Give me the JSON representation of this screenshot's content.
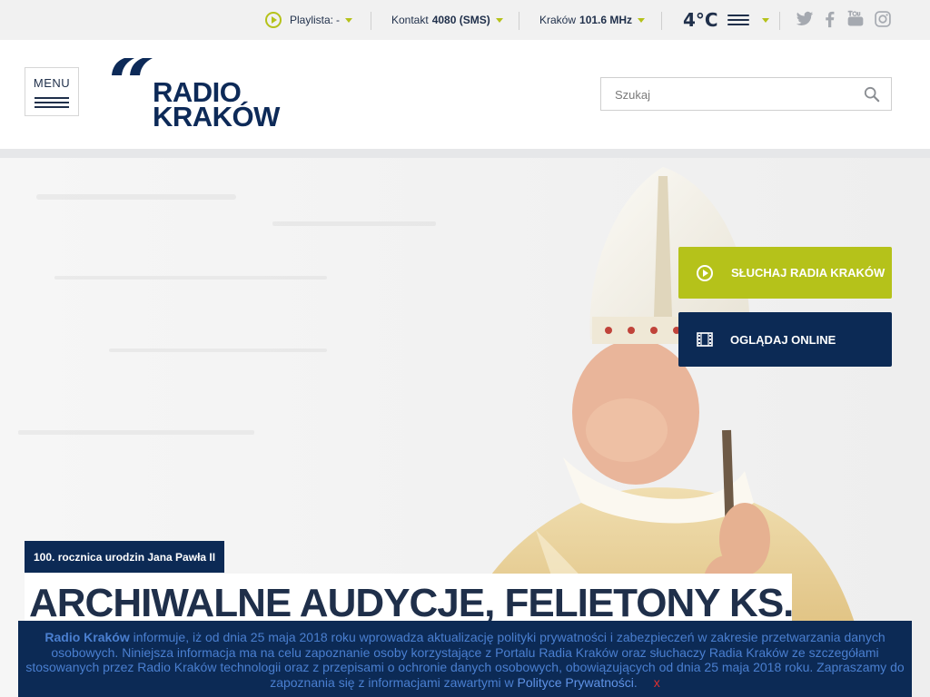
{
  "topbar": {
    "playlist_label": "Playlista:",
    "playlist_value": "-",
    "contact_label": "Kontakt",
    "contact_value": "4080 (SMS)",
    "city_label": "Kraków",
    "frequency": "101.6 MHz",
    "temperature": "4°C",
    "weather_icon": "fog-icon",
    "social": [
      "twitter-icon",
      "facebook-icon",
      "youtube-icon",
      "instagram-icon"
    ]
  },
  "header": {
    "menu_label": "MENU",
    "logo_line1": "RADIO",
    "logo_line2": "KRAKÓW",
    "search_placeholder": "Szukaj"
  },
  "hero": {
    "listen_label": "SŁUCHAJ RADIA KRAKÓW",
    "watch_label": "OGLĄDAJ ONLINE",
    "tag": "100. rocznica urodzin Jana Pawła II",
    "headline": "ARCHIWALNE AUDYCJE, FELIETONY KS."
  },
  "cookie": {
    "brand": "Radio Kraków",
    "text_part1": " informuje, iż od dnia 25 maja 2018 roku wprowadza aktualizację polityki prywatności i zabezpieczeń w zakresie przetwarzania danych osobowych. Niniejsza informacja ma na celu zapoznanie osoby korzystające z Portalu Radia Kraków oraz słuchaczy Radia Kraków ze szczegółami stosowanych przez Radio Kraków technologii oraz z przepisami o ochronie danych osobowych, obowiązujących od dnia 25 maja 2018 roku. Zapraszamy do zapoznania się z informacjami zawartymi w ",
    "link": "Polityce Prywatności",
    "text_end": ".",
    "close": "x"
  },
  "colors": {
    "brand_navy": "#0c2a55",
    "accent_lime": "#b5c21a",
    "topbar_bg": "#f1f1f1"
  }
}
